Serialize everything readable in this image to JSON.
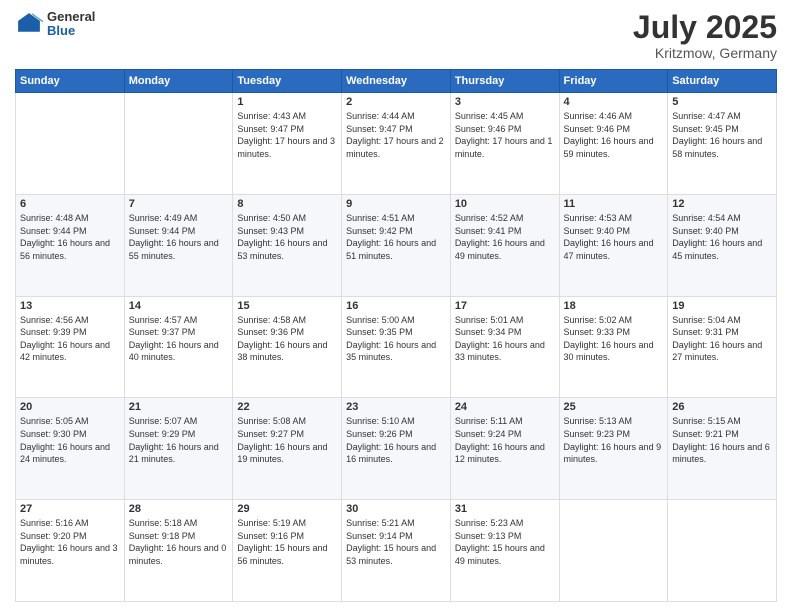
{
  "logo": {
    "general": "General",
    "blue": "Blue"
  },
  "header": {
    "title": "July 2025",
    "subtitle": "Kritzmow, Germany"
  },
  "weekdays": [
    "Sunday",
    "Monday",
    "Tuesday",
    "Wednesday",
    "Thursday",
    "Friday",
    "Saturday"
  ],
  "weeks": [
    [
      {
        "day": null
      },
      {
        "day": null
      },
      {
        "day": "1",
        "sunrise": "4:43 AM",
        "sunset": "9:47 PM",
        "daylight": "17 hours and 3 minutes."
      },
      {
        "day": "2",
        "sunrise": "4:44 AM",
        "sunset": "9:47 PM",
        "daylight": "17 hours and 2 minutes."
      },
      {
        "day": "3",
        "sunrise": "4:45 AM",
        "sunset": "9:46 PM",
        "daylight": "17 hours and 1 minute."
      },
      {
        "day": "4",
        "sunrise": "4:46 AM",
        "sunset": "9:46 PM",
        "daylight": "16 hours and 59 minutes."
      },
      {
        "day": "5",
        "sunrise": "4:47 AM",
        "sunset": "9:45 PM",
        "daylight": "16 hours and 58 minutes."
      }
    ],
    [
      {
        "day": "6",
        "sunrise": "4:48 AM",
        "sunset": "9:44 PM",
        "daylight": "16 hours and 56 minutes."
      },
      {
        "day": "7",
        "sunrise": "4:49 AM",
        "sunset": "9:44 PM",
        "daylight": "16 hours and 55 minutes."
      },
      {
        "day": "8",
        "sunrise": "4:50 AM",
        "sunset": "9:43 PM",
        "daylight": "16 hours and 53 minutes."
      },
      {
        "day": "9",
        "sunrise": "4:51 AM",
        "sunset": "9:42 PM",
        "daylight": "16 hours and 51 minutes."
      },
      {
        "day": "10",
        "sunrise": "4:52 AM",
        "sunset": "9:41 PM",
        "daylight": "16 hours and 49 minutes."
      },
      {
        "day": "11",
        "sunrise": "4:53 AM",
        "sunset": "9:40 PM",
        "daylight": "16 hours and 47 minutes."
      },
      {
        "day": "12",
        "sunrise": "4:54 AM",
        "sunset": "9:40 PM",
        "daylight": "16 hours and 45 minutes."
      }
    ],
    [
      {
        "day": "13",
        "sunrise": "4:56 AM",
        "sunset": "9:39 PM",
        "daylight": "16 hours and 42 minutes."
      },
      {
        "day": "14",
        "sunrise": "4:57 AM",
        "sunset": "9:37 PM",
        "daylight": "16 hours and 40 minutes."
      },
      {
        "day": "15",
        "sunrise": "4:58 AM",
        "sunset": "9:36 PM",
        "daylight": "16 hours and 38 minutes."
      },
      {
        "day": "16",
        "sunrise": "5:00 AM",
        "sunset": "9:35 PM",
        "daylight": "16 hours and 35 minutes."
      },
      {
        "day": "17",
        "sunrise": "5:01 AM",
        "sunset": "9:34 PM",
        "daylight": "16 hours and 33 minutes."
      },
      {
        "day": "18",
        "sunrise": "5:02 AM",
        "sunset": "9:33 PM",
        "daylight": "16 hours and 30 minutes."
      },
      {
        "day": "19",
        "sunrise": "5:04 AM",
        "sunset": "9:31 PM",
        "daylight": "16 hours and 27 minutes."
      }
    ],
    [
      {
        "day": "20",
        "sunrise": "5:05 AM",
        "sunset": "9:30 PM",
        "daylight": "16 hours and 24 minutes."
      },
      {
        "day": "21",
        "sunrise": "5:07 AM",
        "sunset": "9:29 PM",
        "daylight": "16 hours and 21 minutes."
      },
      {
        "day": "22",
        "sunrise": "5:08 AM",
        "sunset": "9:27 PM",
        "daylight": "16 hours and 19 minutes."
      },
      {
        "day": "23",
        "sunrise": "5:10 AM",
        "sunset": "9:26 PM",
        "daylight": "16 hours and 16 minutes."
      },
      {
        "day": "24",
        "sunrise": "5:11 AM",
        "sunset": "9:24 PM",
        "daylight": "16 hours and 12 minutes."
      },
      {
        "day": "25",
        "sunrise": "5:13 AM",
        "sunset": "9:23 PM",
        "daylight": "16 hours and 9 minutes."
      },
      {
        "day": "26",
        "sunrise": "5:15 AM",
        "sunset": "9:21 PM",
        "daylight": "16 hours and 6 minutes."
      }
    ],
    [
      {
        "day": "27",
        "sunrise": "5:16 AM",
        "sunset": "9:20 PM",
        "daylight": "16 hours and 3 minutes."
      },
      {
        "day": "28",
        "sunrise": "5:18 AM",
        "sunset": "9:18 PM",
        "daylight": "16 hours and 0 minutes."
      },
      {
        "day": "29",
        "sunrise": "5:19 AM",
        "sunset": "9:16 PM",
        "daylight": "15 hours and 56 minutes."
      },
      {
        "day": "30",
        "sunrise": "5:21 AM",
        "sunset": "9:14 PM",
        "daylight": "15 hours and 53 minutes."
      },
      {
        "day": "31",
        "sunrise": "5:23 AM",
        "sunset": "9:13 PM",
        "daylight": "15 hours and 49 minutes."
      },
      {
        "day": null
      },
      {
        "day": null
      }
    ]
  ]
}
